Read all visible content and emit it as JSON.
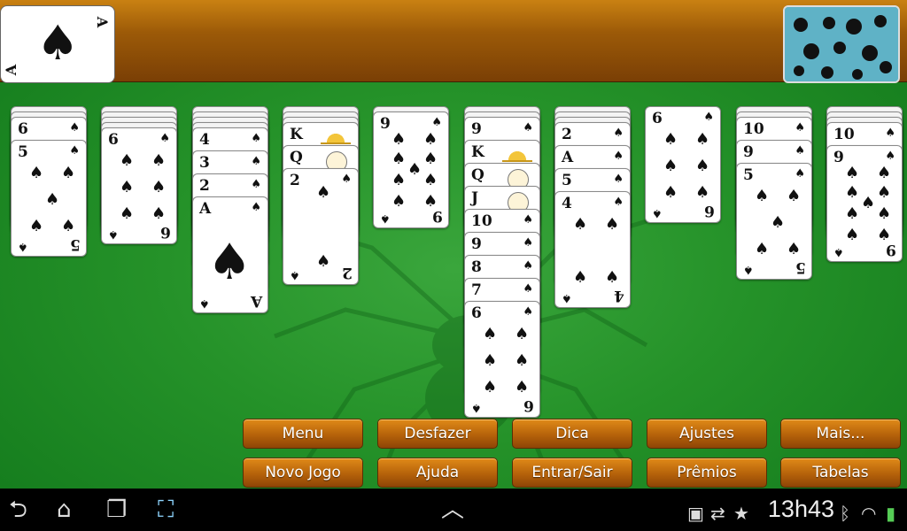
{
  "foundation": {
    "rank": "A",
    "suit": "♠"
  },
  "piles": [
    {
      "down": 2,
      "up": [
        {
          "rank": "6",
          "suit": "♠",
          "pips": 0,
          "partial": true
        },
        {
          "rank": "5",
          "suit": "♠",
          "pips": 5
        }
      ]
    },
    {
      "down": 4,
      "up": [
        {
          "rank": "6",
          "suit": "♠",
          "pips": 6
        }
      ]
    },
    {
      "down": 4,
      "up": [
        {
          "rank": "4",
          "suit": "♠"
        },
        {
          "rank": "3",
          "suit": "♠"
        },
        {
          "rank": "2",
          "suit": "♠"
        },
        {
          "rank": "A",
          "suit": "♠",
          "ace": true
        }
      ]
    },
    {
      "down": 3,
      "up": [
        {
          "rank": "K",
          "suit": "♠",
          "face": "crown"
        },
        {
          "rank": "Q",
          "suit": "♠",
          "face": "queen"
        },
        {
          "rank": "2",
          "suit": "♠",
          "pips": 2
        }
      ]
    },
    {
      "down": 1,
      "up": [
        {
          "rank": "9",
          "suit": "♠",
          "pips": 9
        }
      ]
    },
    {
      "down": 2,
      "up": [
        {
          "rank": "9",
          "suit": "♠"
        },
        {
          "rank": "K",
          "suit": "♠",
          "face": "crown"
        },
        {
          "rank": "Q",
          "suit": "♠",
          "face": "queen"
        },
        {
          "rank": "J",
          "suit": "♠",
          "face": "jack"
        },
        {
          "rank": "10",
          "suit": "♠"
        },
        {
          "rank": "9",
          "suit": "♠"
        },
        {
          "rank": "8",
          "suit": "♠"
        },
        {
          "rank": "7",
          "suit": "♠"
        },
        {
          "rank": "6",
          "suit": "♠",
          "pips": 6
        }
      ]
    },
    {
      "down": 3,
      "up": [
        {
          "rank": "2",
          "suit": "♠"
        },
        {
          "rank": "A",
          "suit": "♠"
        },
        {
          "rank": "5",
          "suit": "♠"
        },
        {
          "rank": "4",
          "suit": "♠",
          "pips": 4
        }
      ]
    },
    {
      "down": 0,
      "up": [
        {
          "rank": "6",
          "suit": "♠",
          "pips": 6
        }
      ]
    },
    {
      "down": 2,
      "up": [
        {
          "rank": "10",
          "suit": "♠"
        },
        {
          "rank": "9",
          "suit": "♠"
        },
        {
          "rank": "5",
          "suit": "♠",
          "pips": 5
        }
      ]
    },
    {
      "down": 3,
      "up": [
        {
          "rank": "10",
          "suit": "♠"
        },
        {
          "rank": "9",
          "suit": "♠",
          "pips": 9
        }
      ]
    }
  ],
  "buttons": {
    "row1": [
      "Menu",
      "Desfazer",
      "Dica",
      "Ajustes",
      "Mais..."
    ],
    "row2": [
      "Novo Jogo",
      "Ajuda",
      "Entrar/Sair",
      "Prêmios",
      "Tabelas"
    ]
  },
  "statusbar": {
    "time": "13h43",
    "icons": [
      "back-icon",
      "home-icon",
      "recent-apps-icon",
      "screenshot-icon",
      "up-chevron-icon",
      "image-icon",
      "sync-icon",
      "star-icon",
      "bluetooth-icon",
      "wifi-icon",
      "battery-icon"
    ]
  },
  "colors": {
    "felt": "#259229",
    "wood": "#9c5a08",
    "button": "#c06a0c"
  }
}
